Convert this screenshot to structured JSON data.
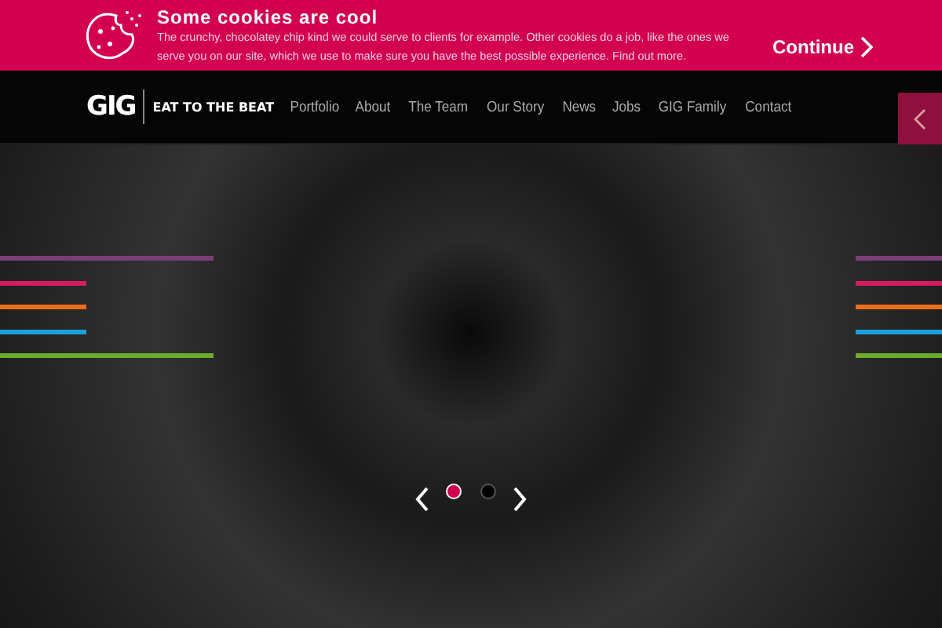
{
  "cookie_banner": {
    "title": "Some cookies are cool",
    "text": "The crunchy, chocolatey chip kind we could serve to clients for example. Other cookies do a job, like the ones we serve you on our site, which we use to make sure you have the best possible experience. Find out more.",
    "button": "Continue"
  },
  "nav": {
    "logo": "GIG",
    "tagline": "EAT TO THE BEAT",
    "items": [
      "Portfolio",
      "About",
      "The Team",
      "Our Story",
      "News",
      "Jobs",
      "GIG Family",
      "Contact"
    ]
  },
  "hero": {
    "left_lines": [
      {
        "color": "#7b3f78",
        "kind": "long"
      },
      {
        "color": "#d81b60",
        "kind": "short"
      },
      {
        "color": "#ef6c1a",
        "kind": "short"
      },
      {
        "color": "#1ea0d8",
        "kind": "short"
      },
      {
        "color": "#6aac2e",
        "kind": "long"
      }
    ],
    "right_lines": [
      {
        "color": "#7b3f78",
        "kind": "short"
      },
      {
        "color": "#d81b60",
        "kind": "short"
      },
      {
        "color": "#ef6c1a",
        "kind": "short"
      },
      {
        "color": "#1ea0d8",
        "kind": "short"
      },
      {
        "color": "#6aac2e",
        "kind": "short"
      }
    ],
    "slides": [
      {
        "selected": true
      },
      {
        "selected": false
      }
    ]
  }
}
